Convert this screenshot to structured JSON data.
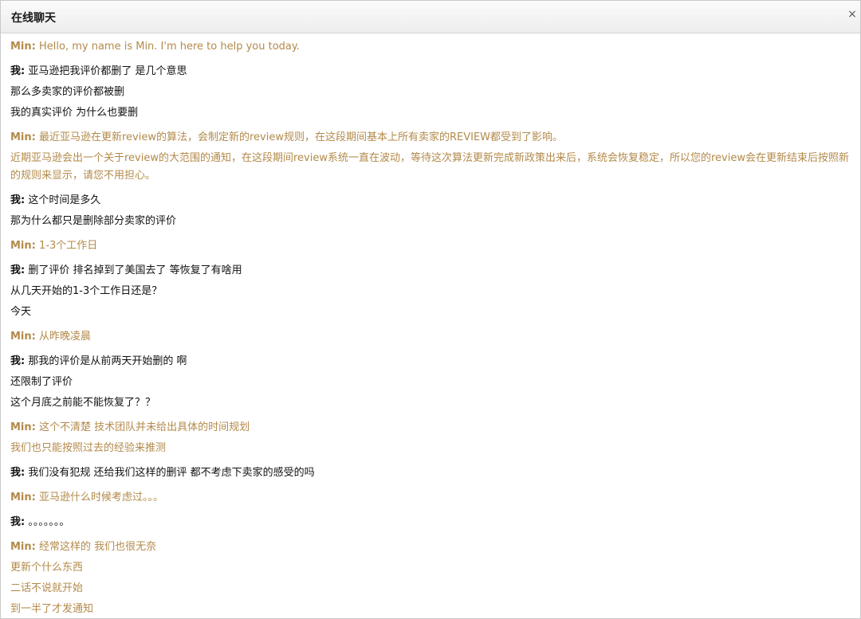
{
  "window": {
    "title": "在线聊天",
    "close_glyph": "×"
  },
  "colors": {
    "agent_text": "#b38a4a",
    "user_text": "#111111"
  },
  "messages": [
    {
      "role": "agent",
      "speaker": "Min:",
      "lines": [
        "Hello, my name is Min. I'm here to help you today."
      ]
    },
    {
      "role": "me",
      "speaker": "我:",
      "lines": [
        "亚马逊把我评价都删了 是几个意思",
        "那么多卖家的评价都被删",
        "我的真实评价 为什么也要删"
      ]
    },
    {
      "role": "agent",
      "speaker": "Min:",
      "lines": [
        "最近亚马逊在更新review的算法，会制定新的review规则，在这段期间基本上所有卖家的REVIEW都受到了影响。",
        "近期亚马逊会出一个关于review的大范围的通知，在这段期间review系统一直在波动，等待这次算法更新完成新政策出来后，系统会恢复稳定，所以您的review会在更新结束后按照新的规则来显示，请您不用担心。"
      ]
    },
    {
      "role": "me",
      "speaker": "我:",
      "lines": [
        "这个时间是多久",
        "那为什么都只是删除部分卖家的评价"
      ]
    },
    {
      "role": "agent",
      "speaker": "Min:",
      "lines": [
        "1-3个工作日"
      ]
    },
    {
      "role": "me",
      "speaker": "我:",
      "lines": [
        "删了评价 排名掉到了美国去了 等恢复了有啥用",
        "从几天开始的1-3个工作日还是？",
        "今天"
      ]
    },
    {
      "role": "agent",
      "speaker": "Min:",
      "lines": [
        "从昨晚凌晨"
      ]
    },
    {
      "role": "me",
      "speaker": "我:",
      "lines": [
        "那我的评价是从前两天开始删的 啊",
        "还限制了评价",
        "这个月底之前能不能恢复了？？"
      ]
    },
    {
      "role": "agent",
      "speaker": "Min:",
      "lines": [
        "这个不清楚 技术团队并未给出具体的时间规划",
        "我们也只能按照过去的经验来推测"
      ]
    },
    {
      "role": "me",
      "speaker": "我:",
      "lines": [
        "我们没有犯规 还给我们这样的删评 都不考虑下卖家的感受的吗"
      ]
    },
    {
      "role": "agent",
      "speaker": "Min:",
      "lines": [
        "亚马逊什么时候考虑过。。。"
      ]
    },
    {
      "role": "me",
      "speaker": "我:",
      "lines": [
        "。。。。。。。"
      ]
    },
    {
      "role": "agent",
      "speaker": "Min:",
      "lines": [
        "经常这样的 我们也很无奈",
        "更新个什么东西",
        "二话不说就开始",
        "到一半了才发通知"
      ]
    }
  ]
}
